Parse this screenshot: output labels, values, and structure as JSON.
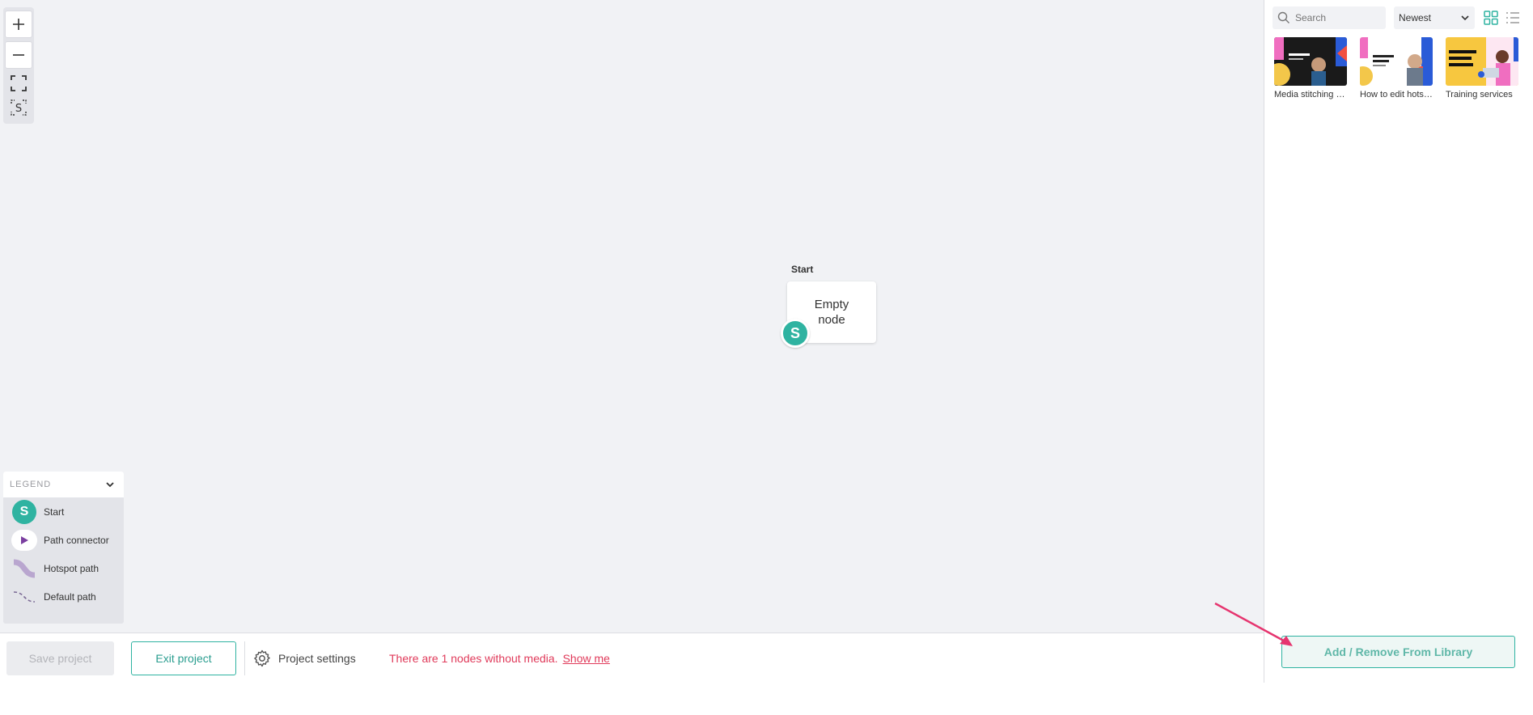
{
  "canvas": {
    "node": {
      "label": "Start",
      "text": "Empty node",
      "badge": "S"
    }
  },
  "legend": {
    "title": "LEGEND",
    "items": [
      {
        "label": "Start",
        "badge": "S",
        "icon": "start-badge-icon"
      },
      {
        "label": "Path connector",
        "icon": "path-connector-icon"
      },
      {
        "label": "Hotspot path",
        "icon": "hotspot-path-icon"
      },
      {
        "label": "Default path",
        "icon": "default-path-icon"
      }
    ]
  },
  "bottom_bar": {
    "save_label": "Save project",
    "exit_label": "Exit project",
    "settings_label": "Project settings",
    "warning_text": "There are 1 nodes without media.",
    "show_me_label": "Show me"
  },
  "panel": {
    "search_placeholder": "Search",
    "sort_value": "Newest",
    "media": [
      {
        "title": "Media stitching - How to stitch media"
      },
      {
        "title": "How to edit hotspots"
      },
      {
        "title": "Training services"
      }
    ],
    "library_button": "Add / Remove From Library"
  },
  "colors": {
    "accent": "#2fb3a1",
    "warning": "#e03a5a",
    "canvas_bg": "#f1f2f5",
    "annotation_arrow": "#e6356f"
  }
}
